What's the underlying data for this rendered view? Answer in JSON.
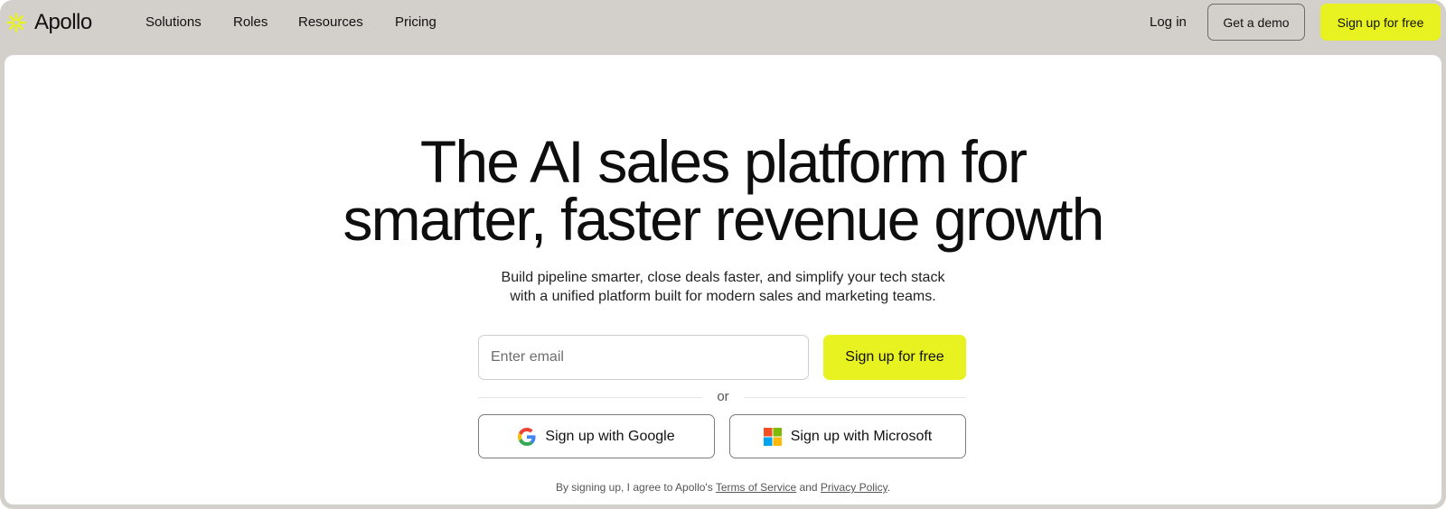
{
  "brand": {
    "name": "Apollo",
    "accent_color": "#e8f221",
    "logo_icon": "sunburst-logo-icon"
  },
  "nav": {
    "links": [
      {
        "label": "Solutions"
      },
      {
        "label": "Roles"
      },
      {
        "label": "Resources"
      },
      {
        "label": "Pricing"
      }
    ],
    "login_label": "Log in",
    "demo_label": "Get a demo",
    "signup_label": "Sign up for free"
  },
  "hero": {
    "headline_line1": "The AI sales platform for",
    "headline_line2": "smarter, faster revenue growth",
    "subtitle_line1": "Build pipeline smarter, close deals faster, and simplify your tech stack",
    "subtitle_line2": "with a unified platform built for modern sales and marketing teams."
  },
  "signup_form": {
    "email_placeholder": "Enter email",
    "email_value": "",
    "submit_label": "Sign up for free",
    "divider_text": "or",
    "google_label": "Sign up with Google",
    "google_icon": "google-icon",
    "microsoft_label": "Sign up with Microsoft",
    "microsoft_icon": "microsoft-icon"
  },
  "legal": {
    "prefix": "By signing up, I agree to Apollo's ",
    "terms_link": "Terms of Service",
    "middle": " and ",
    "privacy_link": "Privacy Policy",
    "suffix": "."
  }
}
